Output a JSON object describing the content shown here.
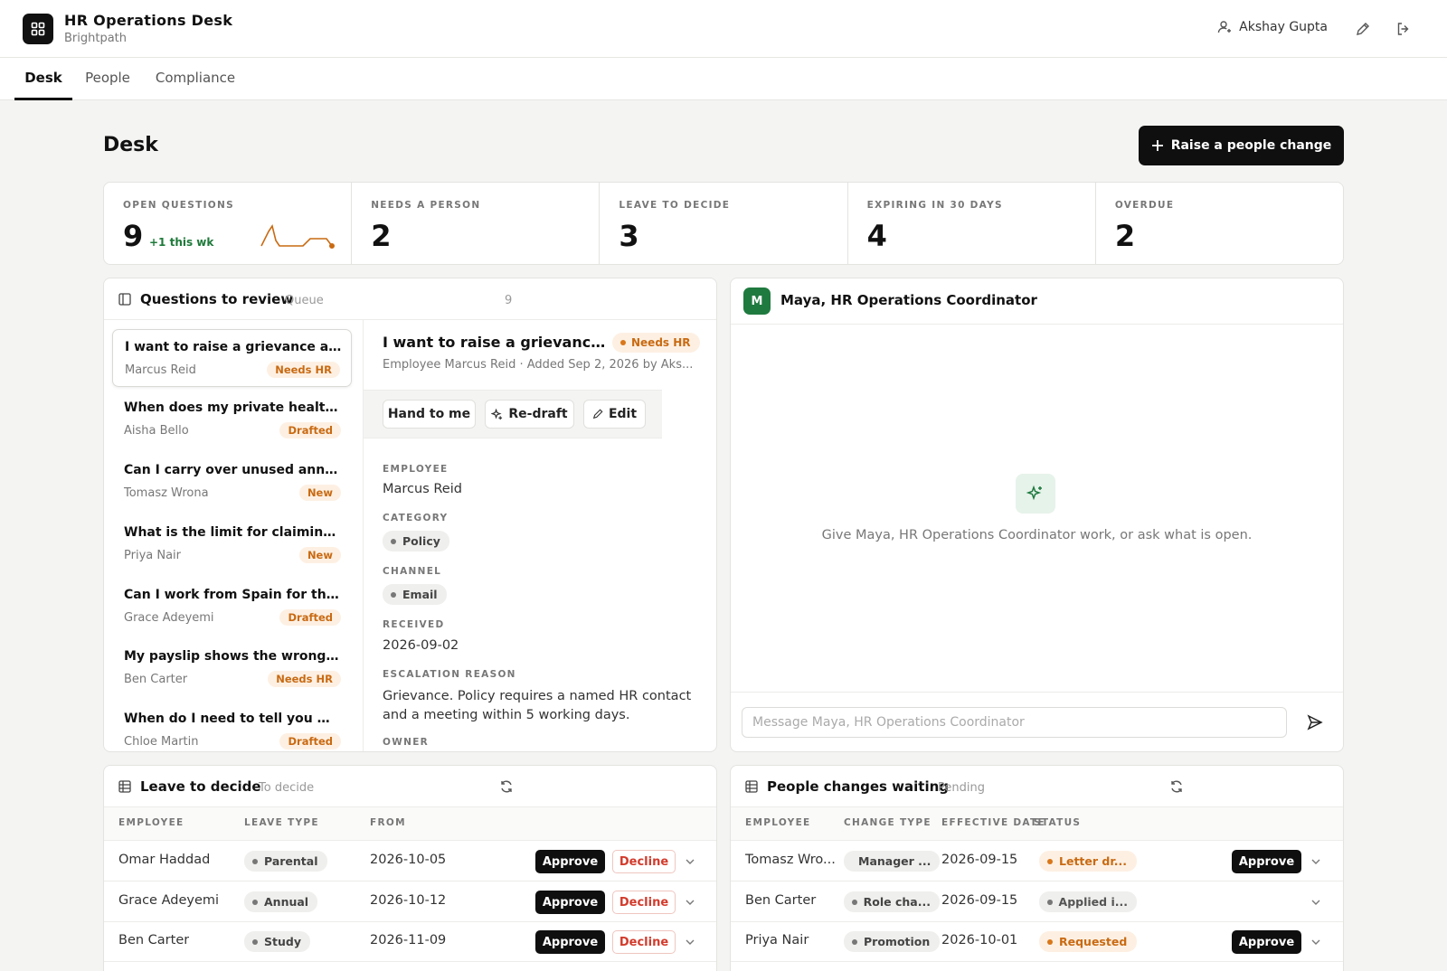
{
  "app": {
    "title": "HR Operations Desk",
    "org": "Brightpath",
    "user": "Akshay Gupta"
  },
  "tabs": [
    {
      "label": "Desk"
    },
    {
      "label": "People"
    },
    {
      "label": "Compliance"
    }
  ],
  "page": {
    "title": "Desk",
    "primary_action": "Raise a people change"
  },
  "kpis": [
    {
      "label": "OPEN QUESTIONS",
      "value": "9",
      "delta": "+1 this wk"
    },
    {
      "label": "NEEDS A PERSON",
      "value": "2"
    },
    {
      "label": "LEAVE TO DECIDE",
      "value": "3"
    },
    {
      "label": "EXPIRING IN 30 DAYS",
      "value": "4"
    },
    {
      "label": "OVERDUE",
      "value": "2"
    }
  ],
  "questions": {
    "title": "Questions to review",
    "subtitle": "Queue",
    "count": "9",
    "items": [
      {
        "title": "I want to raise a grievance abo...",
        "person": "Marcus Reid",
        "status": "Needs HR"
      },
      {
        "title": "When does my private health c...",
        "person": "Aisha Bello",
        "status": "Drafted"
      },
      {
        "title": "Can I carry over unused annual ...",
        "person": "Tomasz Wrona",
        "status": "New"
      },
      {
        "title": "What is the limit for claiming h...",
        "person": "Priya Nair",
        "status": "New"
      },
      {
        "title": "Can I work from Spain for three...",
        "person": "Grace Adeyemi",
        "status": "Drafted"
      },
      {
        "title": "My payslip shows the wrong ta...",
        "person": "Ben Carter",
        "status": "Needs HR"
      },
      {
        "title": "When do I need to tell you my r...",
        "person": "Chloe Martin",
        "status": "Drafted"
      }
    ]
  },
  "detail": {
    "title": "I want to raise a grievance ab...",
    "status": "Needs HR",
    "meta": "Employee Marcus Reid  ·  Added Sep 2, 2026 by Aks...",
    "actions": {
      "hand": "Hand to me",
      "redraft": "Re-draft",
      "edit": "Edit"
    },
    "fields": {
      "employee_label": "EMPLOYEE",
      "employee": "Marcus Reid",
      "category_label": "CATEGORY",
      "category": "Policy",
      "channel_label": "CHANNEL",
      "channel": "Email",
      "received_label": "RECEIVED",
      "received": "2026-09-02",
      "reason_label": "ESCALATION REASON",
      "reason": "Grievance. Policy requires a named HR contact and a meeting within 5 working days.",
      "owner_label": "OWNER"
    }
  },
  "agent": {
    "initial": "M",
    "name": "Maya, HR Operations Coordinator",
    "empty": "Give Maya, HR Operations Coordinator work, or ask what is open.",
    "placeholder": "Message Maya, HR Operations Coordinator"
  },
  "leave": {
    "title": "Leave to decide",
    "subtitle": "To decide",
    "columns": [
      "EMPLOYEE",
      "LEAVE TYPE",
      "FROM"
    ],
    "approve": "Approve",
    "decline": "Decline",
    "rows": [
      {
        "employee": "Omar Haddad",
        "type": "Parental",
        "from": "2026-10-05"
      },
      {
        "employee": "Grace Adeyemi",
        "type": "Annual",
        "from": "2026-10-12"
      },
      {
        "employee": "Ben Carter",
        "type": "Study",
        "from": "2026-11-09"
      }
    ]
  },
  "changes": {
    "title": "People changes waiting",
    "subtitle": "Pending",
    "columns": [
      "EMPLOYEE",
      "CHANGE TYPE",
      "EFFECTIVE DATE",
      "STATUS"
    ],
    "approve": "Approve",
    "rows": [
      {
        "employee": "Tomasz Wro...",
        "type": "Manager ...",
        "date": "2026-09-15",
        "status": "Letter dr...",
        "tone": "orange",
        "approvable": true
      },
      {
        "employee": "Ben Carter",
        "type": "Role cha...",
        "date": "2026-09-15",
        "status": "Applied i...",
        "tone": "gray",
        "approvable": false
      },
      {
        "employee": "Priya Nair",
        "type": "Promotion",
        "date": "2026-10-01",
        "status": "Requested",
        "tone": "orange",
        "approvable": true
      }
    ]
  },
  "colors": {
    "accent": "#111111",
    "warning": "#c96a12",
    "success": "#1f7a3f",
    "danger": "#d23b2c"
  }
}
